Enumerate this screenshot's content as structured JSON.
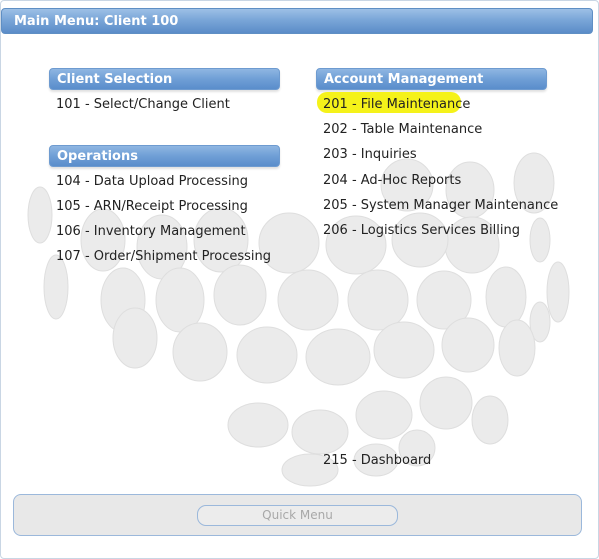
{
  "window": {
    "title": "Main Menu: Client 100"
  },
  "sections": {
    "client_selection": {
      "title": "Client Selection",
      "items": [
        "101 - Select/Change Client"
      ]
    },
    "operations": {
      "title": "Operations",
      "items": [
        "104 - Data Upload Processing",
        "105 - ARN/Receipt Processing",
        "106 - Inventory Management",
        "107 - Order/Shipment Processing"
      ]
    },
    "account_management": {
      "title": "Account Management",
      "items": [
        "201 - File Maintenance",
        "202 - Table Maintenance",
        "203 - Inquiries",
        "204 - Ad-Hoc Reports",
        "205 - System Manager Maintenance",
        "206 - Logistics Services Billing"
      ]
    },
    "other": {
      "items": [
        "215 - Dashboard"
      ]
    }
  },
  "footer": {
    "quick_menu_label": "Quick Menu"
  },
  "colors": {
    "header_blue": "#6f9fd6",
    "highlight_yellow": "#f5f21a",
    "globe_gray": "#ececec"
  }
}
